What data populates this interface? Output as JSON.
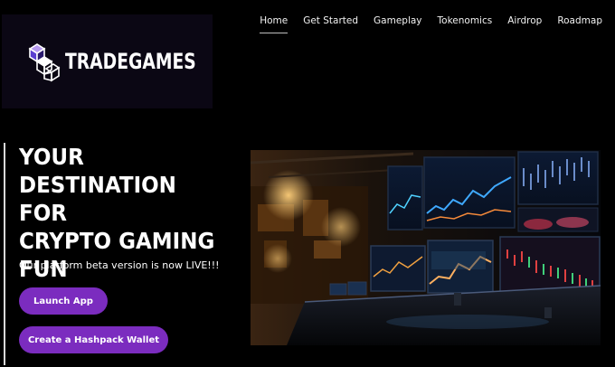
{
  "brand": {
    "name": "TRADEGAMES",
    "logo_icon": "isometric-cubes-icon",
    "accent": "#7b2cbf",
    "logo_bg": "#0b0714"
  },
  "nav": {
    "items": [
      {
        "label": "Home",
        "active": true
      },
      {
        "label": "Get Started",
        "active": false
      },
      {
        "label": "Gameplay",
        "active": false
      },
      {
        "label": "Tokenomics",
        "active": false
      },
      {
        "label": "Airdrop",
        "active": false
      },
      {
        "label": "Roadmap",
        "active": false
      }
    ]
  },
  "hero": {
    "title_lines": [
      "YOUR",
      "DESTINATION FOR",
      "CRYPTO GAMING",
      "FUN"
    ],
    "subtitle": "Our platform beta version is now LIVE!!!",
    "buttons": {
      "launch": "Launch App",
      "hashpack": "Create a Hashpack Wallet"
    },
    "image_icon": "trading-room-illustration"
  }
}
